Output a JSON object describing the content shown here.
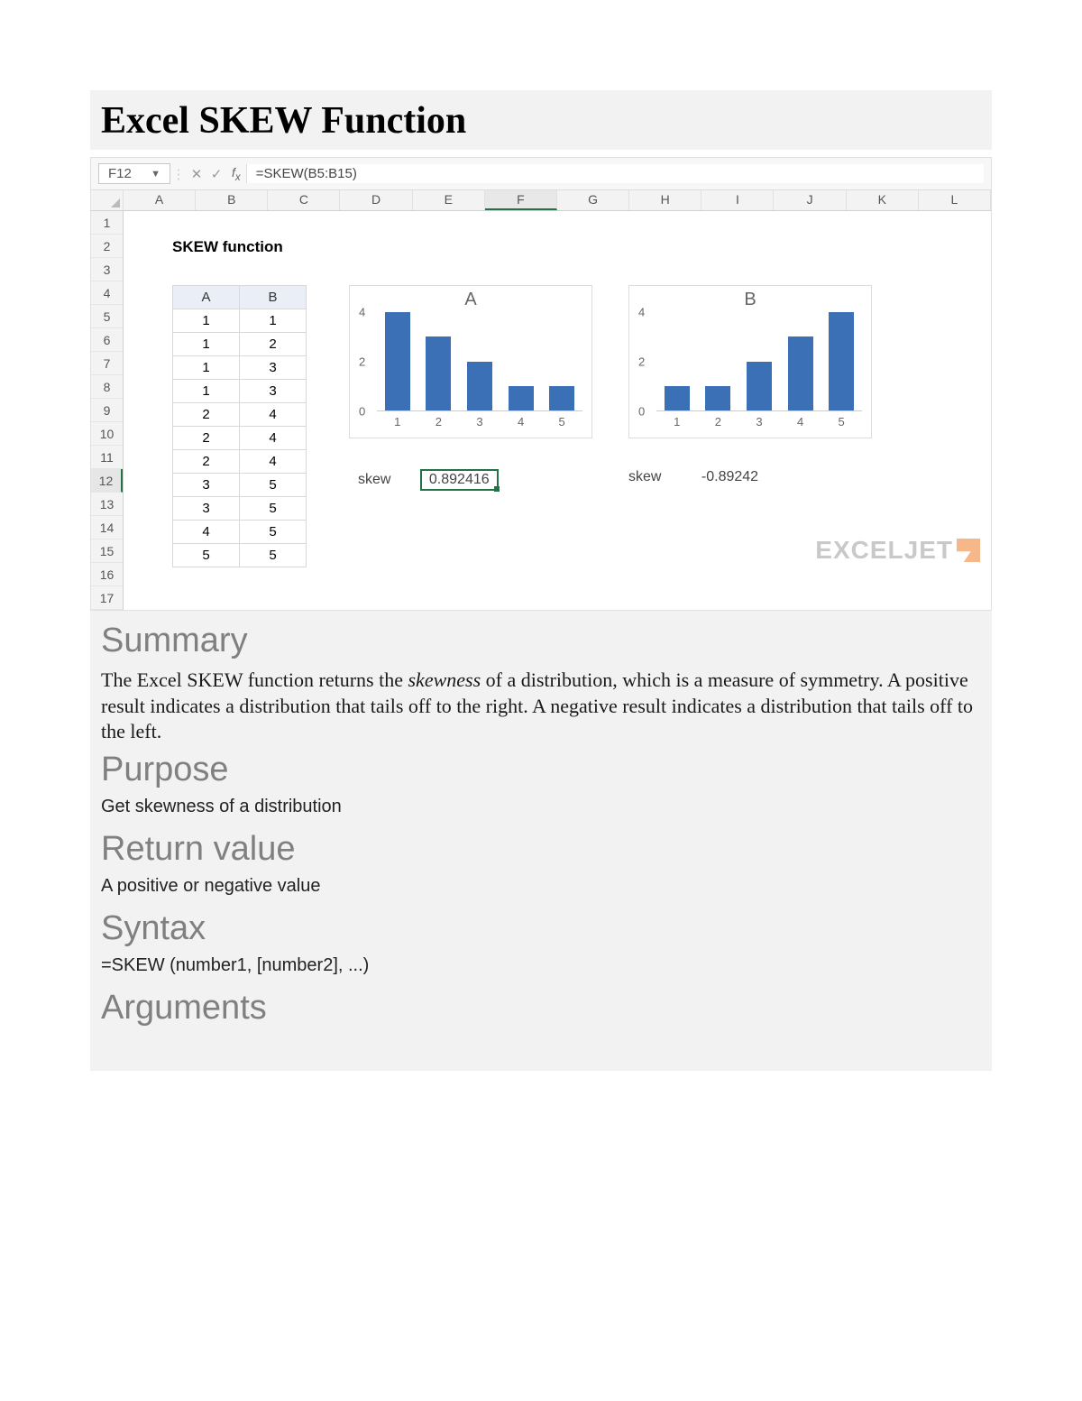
{
  "title": "Excel SKEW Function",
  "excel": {
    "namebox": "F12",
    "formula": "=SKEW(B5:B15)",
    "columns": [
      "A",
      "B",
      "C",
      "D",
      "E",
      "F",
      "G",
      "H",
      "I",
      "J",
      "K",
      "L"
    ],
    "selected_col": "F",
    "rows": [
      "1",
      "2",
      "3",
      "4",
      "5",
      "6",
      "7",
      "8",
      "9",
      "10",
      "11",
      "12",
      "13",
      "14",
      "15",
      "16",
      "17"
    ],
    "selected_row": "12",
    "skew_label": "SKEW function",
    "table_headers": [
      "A",
      "B"
    ],
    "table_rows": [
      [
        "1",
        "1"
      ],
      [
        "1",
        "2"
      ],
      [
        "1",
        "3"
      ],
      [
        "1",
        "3"
      ],
      [
        "2",
        "4"
      ],
      [
        "2",
        "4"
      ],
      [
        "2",
        "4"
      ],
      [
        "3",
        "5"
      ],
      [
        "3",
        "5"
      ],
      [
        "4",
        "5"
      ],
      [
        "5",
        "5"
      ]
    ],
    "skew_word": "skew",
    "result_a": "0.892416",
    "result_b": "-0.89242",
    "watermark": "EXCELJET"
  },
  "chart_data": [
    {
      "type": "bar",
      "title": "A",
      "categories": [
        "1",
        "2",
        "3",
        "4",
        "5"
      ],
      "values": [
        4,
        3,
        2,
        1,
        1
      ],
      "yticks": [
        "4",
        "2",
        "0"
      ],
      "ylim": [
        0,
        4
      ]
    },
    {
      "type": "bar",
      "title": "B",
      "categories": [
        "1",
        "2",
        "3",
        "4",
        "5"
      ],
      "values": [
        1,
        1,
        2,
        3,
        4
      ],
      "yticks": [
        "4",
        "2",
        "0"
      ],
      "ylim": [
        0,
        4
      ]
    }
  ],
  "sections": {
    "summary_h": "Summary",
    "summary_p_pre": "The Excel SKEW function returns the ",
    "summary_em": "skewness",
    "summary_p_post": " of a distribution, which is a measure of symmetry. A positive result indicates a distribution that tails off to the right. A negative result indicates a distribution that tails off to the left.",
    "purpose_h": "Purpose",
    "purpose_p": "Get skewness of a distribution",
    "return_h": "Return value",
    "return_p": "A positive or negative value",
    "syntax_h": "Syntax",
    "syntax_p": "=SKEW (number1, [number2], ...)",
    "arguments_h": "Arguments"
  }
}
